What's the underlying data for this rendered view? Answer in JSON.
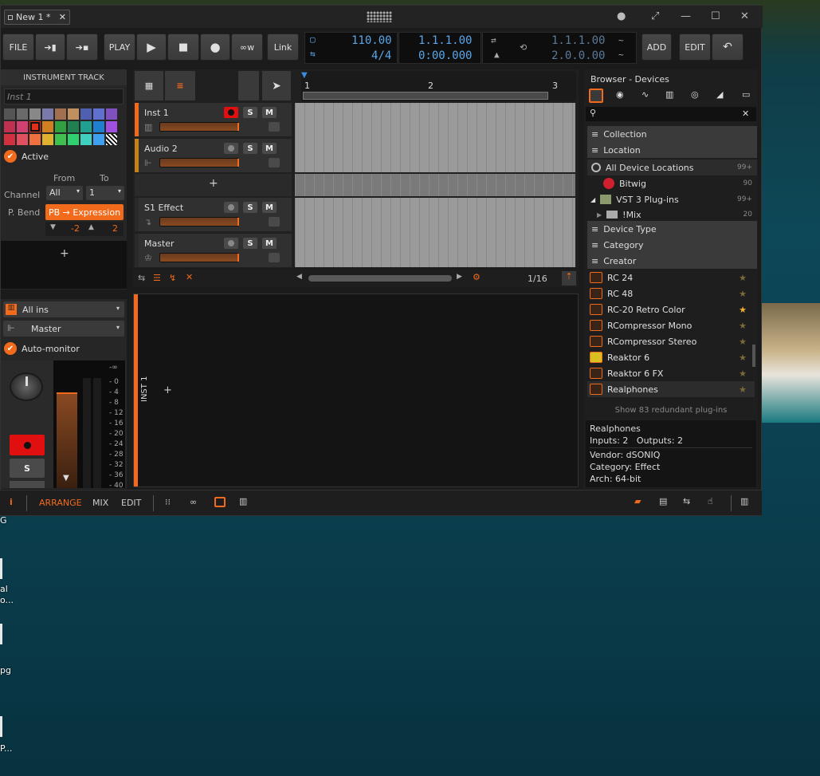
{
  "window": {
    "tab_title": "New 1 *",
    "close_tab": "✕"
  },
  "titlebar": {
    "dot": "●",
    "restore": "⤢",
    "minimize": "—",
    "maximize": "☐",
    "close": "✕"
  },
  "toolbar": {
    "file": "FILE",
    "play_label": "PLAY",
    "link": "Link",
    "tempo": "110.00",
    "signature": "4/4",
    "position_bars": "1.1.1.00",
    "position_time": "0:00.000",
    "loop_start": "1.1.1.00",
    "loop_end": "2.0.0.00",
    "add": "ADD",
    "edit": "EDIT"
  },
  "inspector": {
    "header": "INSTRUMENT TRACK",
    "name_value": "Inst 1",
    "active": "Active",
    "from": "From",
    "to": "To",
    "channel": "Channel",
    "channel_from": "All",
    "channel_to": "1",
    "pbend": "P. Bend",
    "pb_expression": "PB → Expression",
    "pb_low": "-2",
    "pb_high": "2",
    "add": "+",
    "input": "All ins",
    "output": "Master",
    "auto_monitor": "Auto-monitor",
    "solo": "S",
    "meter_top": "-∞",
    "meter_scale": [
      "0",
      "4",
      "8",
      "12",
      "16",
      "20",
      "24",
      "28",
      "32",
      "36",
      "40"
    ],
    "palette": [
      "#555555",
      "#6a6a6a",
      "#888888",
      "#7a7aaa",
      "#a07050",
      "#c09060",
      "#5060b0",
      "#6070d0",
      "#8050c0",
      "#c03050",
      "#d04070",
      "#e0301a",
      "#d08020",
      "#30a040",
      "#208050",
      "#20a090",
      "#2080d0",
      "#a050e0",
      "#d03040",
      "#e05060",
      "#f07040",
      "#e0b030",
      "#40c050",
      "#30d070",
      "#40d0c0",
      "#40a0f0",
      "stripe"
    ]
  },
  "tracks": [
    {
      "name": "Inst 1"
    },
    {
      "name": "Audio 2"
    },
    {
      "name": "S1 Effect"
    },
    {
      "name": "Master"
    }
  ],
  "arranger": {
    "ruler": [
      "1",
      "2",
      "3"
    ],
    "add_track": "+",
    "quantize": "1/16"
  },
  "detail": {
    "track_label": "INST 1",
    "add": "+"
  },
  "browser": {
    "title": "Browser - Devices",
    "search_clear": "✕",
    "sections": {
      "collection": "Collection",
      "location": "Location",
      "device_type": "Device Type",
      "category": "Category",
      "creator": "Creator"
    },
    "locations": [
      {
        "name": "All Device Locations",
        "count": "99+"
      },
      {
        "name": "Bitwig",
        "count": "90"
      },
      {
        "name": "VST 3 Plug-ins",
        "count": "99+"
      },
      {
        "name": "!Mix",
        "count": "20"
      }
    ],
    "plugins": [
      {
        "name": "RC 24",
        "fav": false
      },
      {
        "name": "RC 48",
        "fav": false
      },
      {
        "name": "RC-20 Retro Color",
        "fav": true
      },
      {
        "name": "RCompressor Mono",
        "fav": false
      },
      {
        "name": "RCompressor Stereo",
        "fav": false
      },
      {
        "name": "Reaktor 6",
        "fav": false
      },
      {
        "name": "Reaktor 6 FX",
        "fav": false
      },
      {
        "name": "Realphones",
        "fav": false
      }
    ],
    "redundant": "Show 83 redundant plug-ins",
    "info": {
      "name": "Realphones",
      "io": "Inputs: 2   Outputs: 2",
      "vendor": "Vendor: dSONIQ",
      "category": "Category: Effect",
      "arch": "Arch: 64-bit"
    }
  },
  "bottom": {
    "info": "i",
    "arrange": "ARRANGE",
    "mix": "MIX",
    "edit": "EDIT"
  },
  "desktop": {
    "labels": [
      "G",
      "al",
      "o...",
      "pg",
      "P..."
    ]
  },
  "colors": {
    "accent": "#f26a1b",
    "blue": "#5aa6e8",
    "record": "#e01010"
  }
}
